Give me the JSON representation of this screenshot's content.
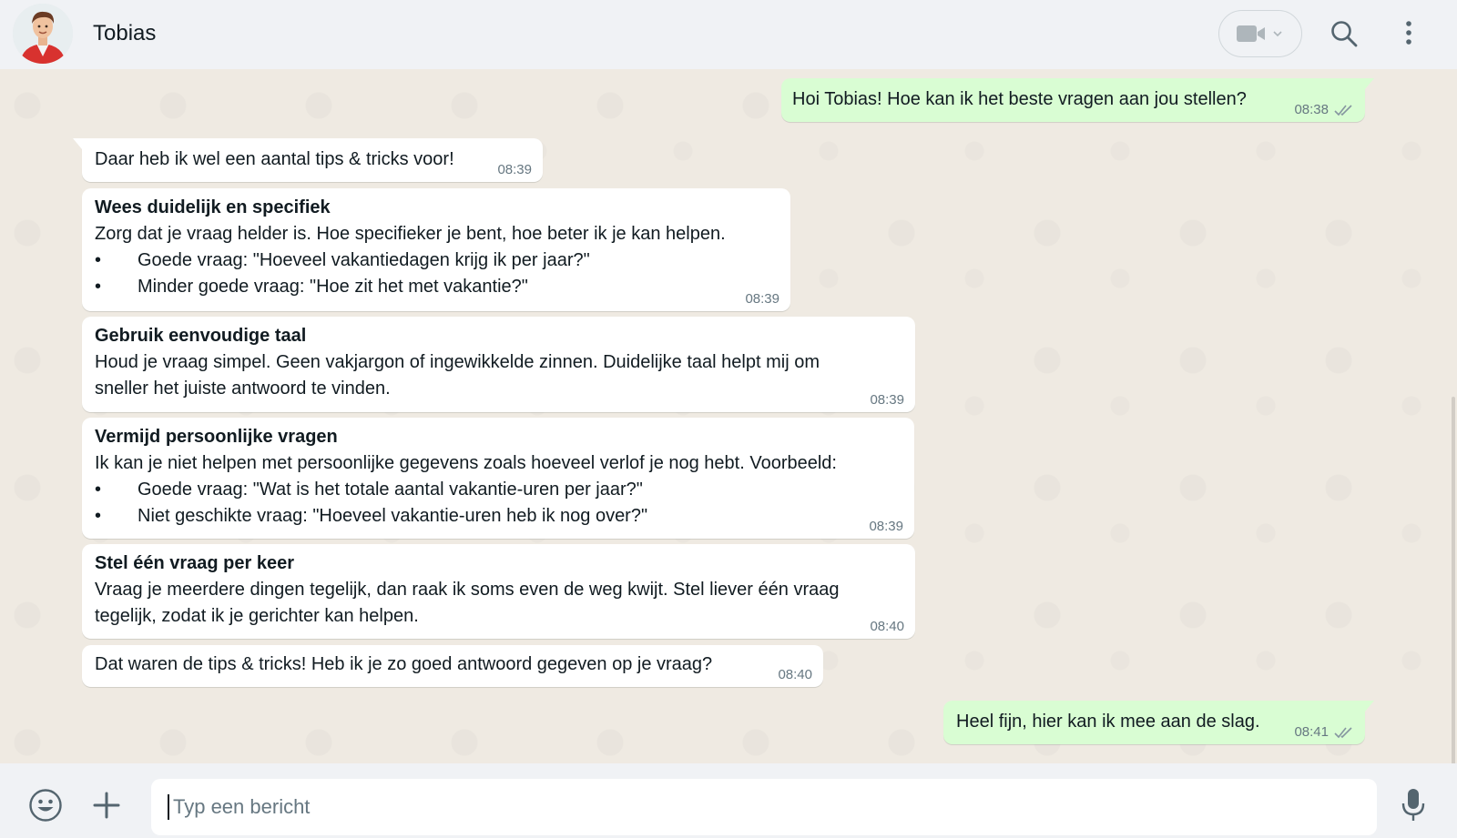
{
  "header": {
    "contact_name": "Tobias"
  },
  "messages": [
    {
      "direction": "out",
      "text": "Hoi Tobias! Hoe kan ik het beste vragen aan jou stellen?",
      "time": "08:38",
      "status": "read"
    },
    {
      "direction": "in",
      "text": "Daar heb ik wel een aantal tips & tricks voor!",
      "time": "08:39"
    },
    {
      "direction": "in",
      "title": "Wees duidelijk en specifiek",
      "lines": [
        "Zorg dat je vraag helder is. Hoe specifieker je bent, hoe beter ik je kan helpen."
      ],
      "bullets": [
        "Goede vraag: \"Hoeveel vakantiedagen krijg ik per jaar?\"",
        "Minder goede vraag: \"Hoe zit het met vakantie?\""
      ],
      "time": "08:39"
    },
    {
      "direction": "in",
      "title": "Gebruik eenvoudige taal",
      "lines": [
        "Houd je vraag simpel. Geen vakjargon of ingewikkelde zinnen. Duidelijke taal helpt mij om",
        "sneller het juiste antwoord te vinden."
      ],
      "time": "08:39"
    },
    {
      "direction": "in",
      "title": "Vermijd persoonlijke vragen",
      "lines": [
        "Ik kan je niet helpen met persoonlijke gegevens zoals hoeveel verlof je nog hebt. Voorbeeld:"
      ],
      "bullets": [
        "Goede vraag: \"Wat is het totale aantal vakantie-uren per jaar?\"",
        "Niet geschikte vraag: \"Hoeveel vakantie-uren heb ik nog over?\""
      ],
      "time": "08:39"
    },
    {
      "direction": "in",
      "title": "Stel één vraag per keer",
      "lines": [
        "Vraag je meerdere dingen tegelijk, dan raak ik soms even de weg kwijt. Stel liever één vraag",
        "tegelijk, zodat ik je gerichter kan helpen."
      ],
      "time": "08:40"
    },
    {
      "direction": "in",
      "text": "Dat waren de tips & tricks! Heb ik je zo goed antwoord gegeven op je vraag?",
      "time": "08:40"
    },
    {
      "direction": "out",
      "text": "Heel fijn, hier kan ik mee aan de slag.",
      "time": "08:41",
      "status": "read"
    }
  ],
  "composer": {
    "placeholder": "Typ een bericht"
  },
  "icons": {
    "header": [
      "video-call-icon",
      "chevron-down-icon",
      "search-icon",
      "menu-dots-icon"
    ],
    "composer": [
      "emoji-icon",
      "plus-icon",
      "microphone-icon"
    ],
    "status": "double-check-icon"
  },
  "colors": {
    "outgoing_bubble": "#d9fdd3",
    "incoming_bubble": "#ffffff",
    "chat_background": "#efeae2",
    "header_background": "#f0f2f5",
    "read_ticks": "#8696a0"
  }
}
